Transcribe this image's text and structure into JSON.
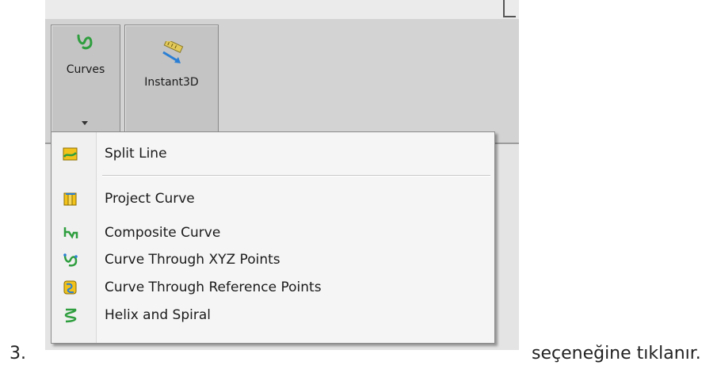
{
  "step_number": "3.",
  "caption_text": "seçeneğine tıklanır.",
  "ribbon": {
    "curves_button": {
      "label": "Curves",
      "icon": "curves-icon"
    },
    "instant3d_button": {
      "label": "Instant3D",
      "icon": "instant3d-icon"
    }
  },
  "menu": {
    "items": [
      {
        "label": "Split Line",
        "icon": "split-line-icon"
      },
      {
        "label": "Project Curve",
        "icon": "project-curve-icon"
      },
      {
        "label": "Composite Curve",
        "icon": "composite-curve-icon"
      },
      {
        "label": "Curve Through XYZ Points",
        "icon": "curve-xyz-icon"
      },
      {
        "label": "Curve Through Reference Points",
        "icon": "curve-reference-points-icon"
      },
      {
        "label": "Helix and Spiral",
        "icon": "helix-spiral-icon"
      }
    ]
  },
  "colors": {
    "ribbon_bg": "#d3d3d3",
    "button_bg": "#c4c4c4",
    "menu_bg": "#f5f5f5",
    "icon_green": "#2e9e3e",
    "icon_yellow": "#f2c21b"
  }
}
